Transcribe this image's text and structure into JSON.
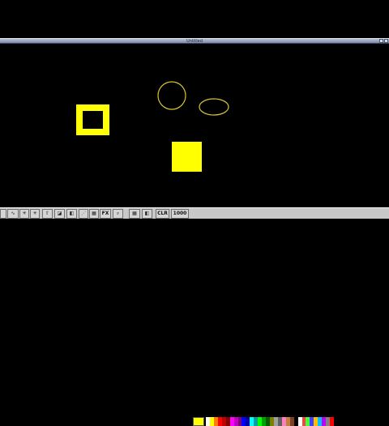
{
  "window": {
    "title": "Untitled"
  },
  "toolbar": {
    "tools": [
      {
        "name": "select-tool-button",
        "glyph": ""
      },
      {
        "name": "curve-tool-button",
        "glyph": "∿"
      },
      {
        "name": "spray-tool-button",
        "glyph": "✳"
      },
      {
        "name": "fill-tool-button",
        "glyph": "⇧"
      },
      {
        "name": "shade-tool-button",
        "glyph": "◪"
      },
      {
        "name": "box-tool-button",
        "glyph": "◧"
      },
      {
        "name": "grid-tool-button",
        "glyph": "⋰"
      },
      {
        "name": "pattern-tool-button",
        "glyph": "▦"
      }
    ],
    "fx_label": "FX",
    "zoom_glyph": "⌕",
    "clr_label": "CLR",
    "coord_label": "1000"
  },
  "palette": {
    "current_color": "#ffff00",
    "colors": [
      "#ffffff",
      "#ffff00",
      "#ff8000",
      "#ff0000",
      "#c00000",
      "#800000",
      "#ff00ff",
      "#c000c0",
      "#800080",
      "#0000ff",
      "#0000a0",
      "#00ffff",
      "#00a0a0",
      "#00ff00",
      "#00a000",
      "#006000",
      "#808000",
      "#a0a0a0",
      "#606060",
      "#ff80c0",
      "#c08040",
      "#804020",
      "#000000",
      "#ffffff",
      "#ff4040",
      "#40ff40",
      "#4040ff",
      "#ffc000",
      "#00c0ff",
      "#c000ff",
      "#808080",
      "#ff0000"
    ]
  },
  "shapes": {
    "square_outline_color": "#ffff00",
    "filled_square_color": "#ffff00",
    "circle_color": "#d8c830",
    "ellipse_color": "#d8c830"
  }
}
